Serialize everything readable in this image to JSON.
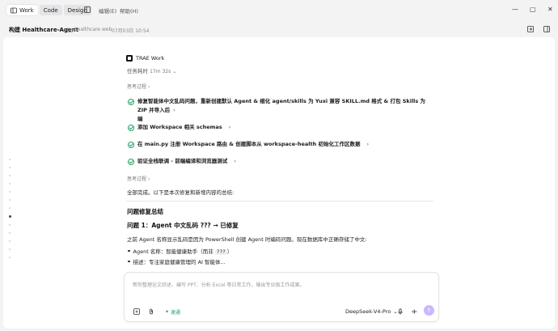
{
  "titlebar": {
    "tabs": [
      {
        "label": "Work",
        "active": true
      },
      {
        "label": "Code",
        "active": false
      },
      {
        "label": "Design",
        "active": false
      }
    ],
    "menus": [
      "编辑(E)",
      "帮助(H)"
    ],
    "window_controls": {
      "minimize": "—",
      "maximize": "▢",
      "close": "✕"
    }
  },
  "header": {
    "title": "构建 Healthcare-Agent",
    "folder": "healthcare web",
    "timestamp": "07月03日 10:54"
  },
  "content": {
    "brand": "TRAE Work",
    "elapsed_label": "任务耗时",
    "elapsed_value": "17m 32s",
    "thinking_label": "思考过程",
    "steps": [
      {
        "text": "修复智能体中文乱码问题，重新创建默认 Agent & 细化 agent/skills 为 Yuxi 兼容 SKILL.md 格式 & 打包 Skills 为 ZIP 并导入后",
        "cont": "端"
      },
      {
        "text": "添加 Workspace 相关 schemas"
      },
      {
        "text": "在 main.py 注册 Workspace 路由 & 创建脚本从 workspace-health 初始化工作区数据"
      },
      {
        "text": "验证全栈联调 - 前端编译和浏览器测试"
      }
    ],
    "thinking_label_2": "思考过程",
    "summary": "全部完成。以下是本次修复和新增内容的总结:",
    "h1": "问题修复总结",
    "h2": "问题 1：Agent 中文乱码 ??? → 已修复",
    "paragraph": "之前 Agent 名称显示乱码是因为 PowerShell 创建 Agent 时编码问题。现在数据库中正确存储了中文:",
    "bullet1_prefix": "Agent 名称：智能健康助手（而非",
    "bullet1_code": "???",
    "bullet1_suffix": "）",
    "bullet2": "描述：专注家庭健康管理的 AI 智能体..."
  },
  "composer": {
    "placeholder": "帮你整理论文综述、编写 PPT、分析 Excel 等日常工作，输出专业级工作成果。",
    "mode": "速通",
    "model": "DeepSeek-V4-Pro",
    "send": "↑"
  },
  "colors": {
    "accent_green": "#21a366",
    "send_button": "#c9b8ff"
  }
}
